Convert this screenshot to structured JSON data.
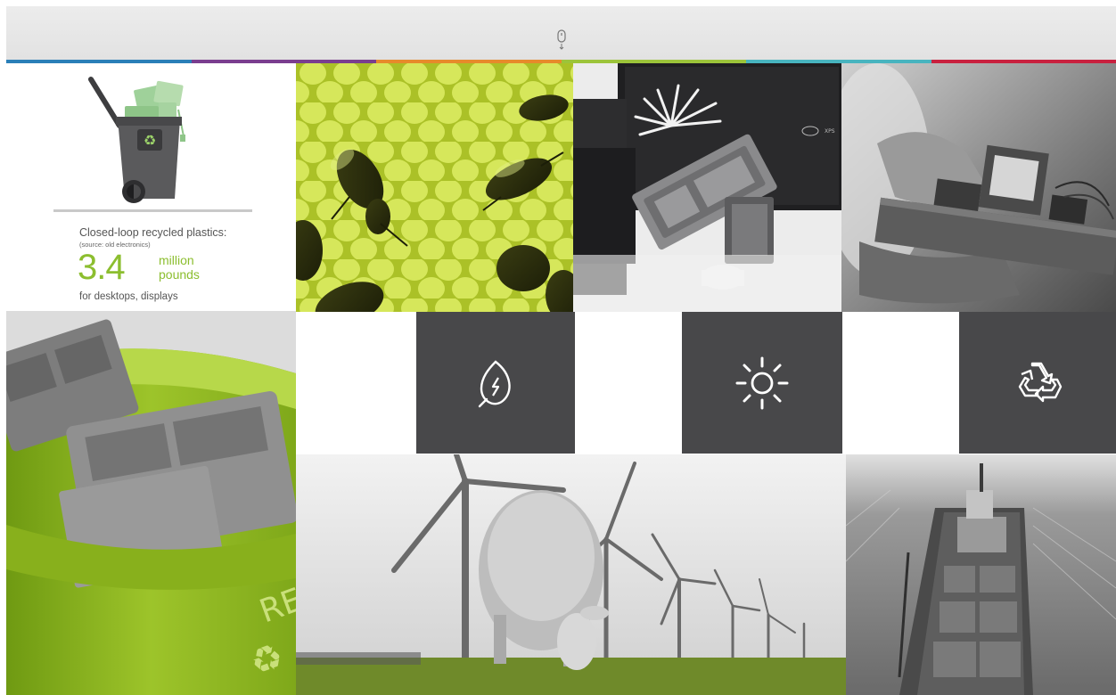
{
  "header": {
    "scroll_icon": "mouse-scroll-icon"
  },
  "color_strip": [
    "#2a7fb8",
    "#7a3e8f",
    "#e78a2b",
    "#9cc43a",
    "#48b4bf",
    "#c9213f"
  ],
  "infographic": {
    "heading": "Closed-loop recycled plastics:",
    "source": "(source: old electronics)",
    "number": "3.4",
    "unit_line1": "million",
    "unit_line2": "pounds",
    "caption": "for desktops, displays",
    "accent_color": "#8cbe2f",
    "icon": "recycling-bin-icon"
  },
  "laptop_tile": {
    "brand_text": "XPS"
  },
  "feature_icons": [
    {
      "icon": "leaf-energy-icon"
    },
    {
      "icon": "sun-icon"
    },
    {
      "icon": "recycle-icon"
    }
  ]
}
